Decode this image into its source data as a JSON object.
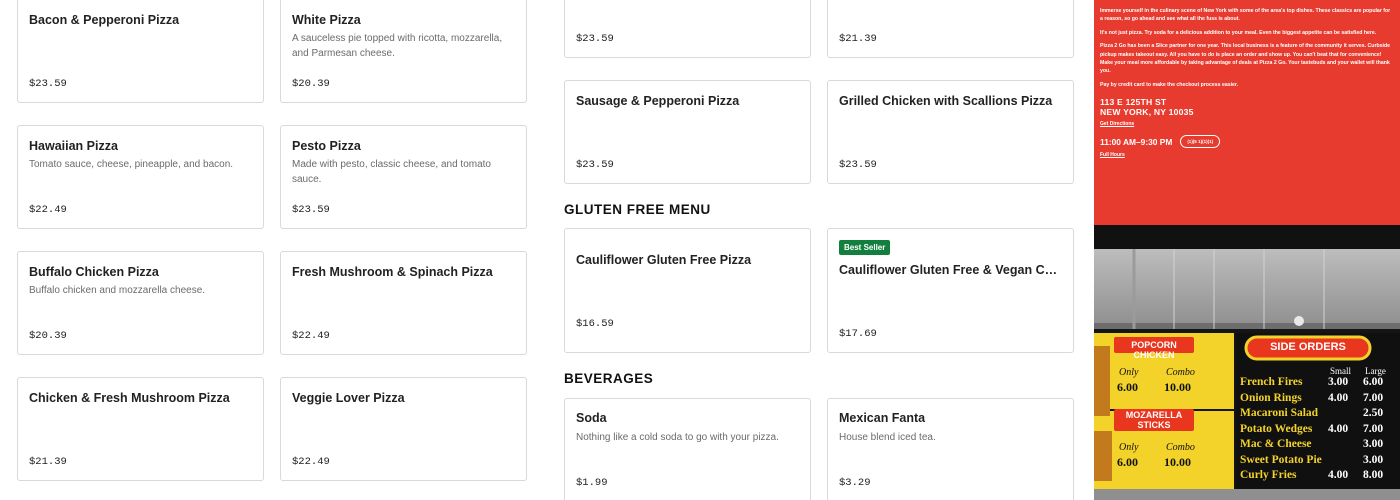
{
  "menu": {
    "col1": [
      {
        "name": "Bacon & Pepperoni Pizza",
        "desc": "",
        "price": "$23.59"
      },
      {
        "name": "Hawaiian Pizza",
        "desc": "Tomato sauce, cheese, pineapple, and bacon.",
        "price": "$22.49"
      },
      {
        "name": "Buffalo Chicken Pizza",
        "desc": "Buffalo chicken and mozzarella cheese.",
        "price": "$20.39"
      },
      {
        "name": "Chicken & Fresh Mushroom Pizza",
        "desc": "",
        "price": "$21.39"
      }
    ],
    "col2": [
      {
        "name": "White Pizza",
        "desc": "A sauceless pie topped with ricotta, mozzarella, and Parmesan cheese.",
        "price": "$20.39"
      },
      {
        "name": "Pesto Pizza",
        "desc": "Made with pesto, classic cheese, and tomato sauce.",
        "price": "$23.59"
      },
      {
        "name": "Fresh Mushroom & Spinach Pizza",
        "desc": "",
        "price": "$22.49"
      },
      {
        "name": "Veggie Lover Pizza",
        "desc": "",
        "price": "$22.49"
      }
    ],
    "col3_top": [
      {
        "price": "$23.59"
      },
      {
        "name": "Sausage & Pepperoni Pizza",
        "price": "$23.59"
      }
    ],
    "col4_top": [
      {
        "price": "$21.39"
      },
      {
        "name": "Grilled Chicken with Scallions Pizza",
        "price": "$23.59"
      }
    ]
  },
  "gluten_free": {
    "title": "GLUTEN FREE MENU",
    "items": [
      {
        "name": "Cauliflower Gluten Free Pizza",
        "price": "$16.59"
      },
      {
        "badge": "Best Seller",
        "name": "Cauliflower Gluten Free & Vegan Cheese Pizza",
        "price": "$17.69"
      }
    ]
  },
  "beverages": {
    "title": "BEVERAGES",
    "items": [
      {
        "name": "Soda",
        "desc": "Nothing like a cold soda to go with your pizza.",
        "price": "$1.99"
      },
      {
        "name": "Mexican Fanta",
        "desc": "House blend iced tea.",
        "price": "$3.29"
      }
    ]
  },
  "promo": {
    "p1": "Immerse yourself in the culinary scene of New York with some of the area's top dishes. These classics are popular for a reason, so go ahead and see what all the fuss is about.",
    "p2": "It's not just pizza. Try soda for a delicious addition to your meal. Even the biggest appetite can be satisfied here.",
    "p3": "Pizza 2 Go has been a Slice partner for one year. This local business is a feature of the community it serves. Curbside pickup makes takeout easy. All you have to do is place an order and show up. You can't beat that for convenience! Make your meal more affordable by taking advantage of deals at Pizza 2 Go. Your tastebuds and your wallet will thank you.",
    "p4": "Pay by credit card to make the checkout process easier.",
    "address_line1": "113 E 125TH ST",
    "address_line2": "NEW YORK, NY 10035",
    "directions_link": "Get Directions",
    "hours": "11:00 AM–9:30 PM",
    "phone": "(1)(5 1)(1)(1)",
    "full_hours_link": "Full Hours"
  },
  "photo": {
    "sign1_title": "POPCORN CHICKEN",
    "sign1_only": "Only",
    "sign1_combo": "Combo",
    "sign1_price_only": "6.00",
    "sign1_price_combo": "10.00",
    "sign2_title": "MOZARELLA STICKS",
    "sign2_only": "Only",
    "sign2_combo": "Combo",
    "sign2_price_only": "6.00",
    "sign2_price_combo": "10.00",
    "side_title": "SIDE ORDERS",
    "small_label": "Small",
    "large_label": "Large",
    "sides": [
      {
        "name": "French Fires",
        "small": "3.00",
        "large": "6.00"
      },
      {
        "name": "Onion Rings",
        "small": "4.00",
        "large": "7.00"
      },
      {
        "name": "Macaroni Salad",
        "small": "",
        "large": "2.50"
      },
      {
        "name": "Potato Wedges",
        "small": "4.00",
        "large": "7.00"
      },
      {
        "name": "Mac & Cheese",
        "small": "",
        "large": "3.00"
      },
      {
        "name": "Sweet Potato Pie",
        "small": "",
        "large": "3.00"
      },
      {
        "name": "Curly Fries",
        "small": "4.00",
        "large": "8.00"
      }
    ]
  },
  "colors": {
    "promo_red": "#e63b2e",
    "badge_green": "#127f3e",
    "sign_yellow": "#f3d22a",
    "sign_red": "#e8361f"
  }
}
